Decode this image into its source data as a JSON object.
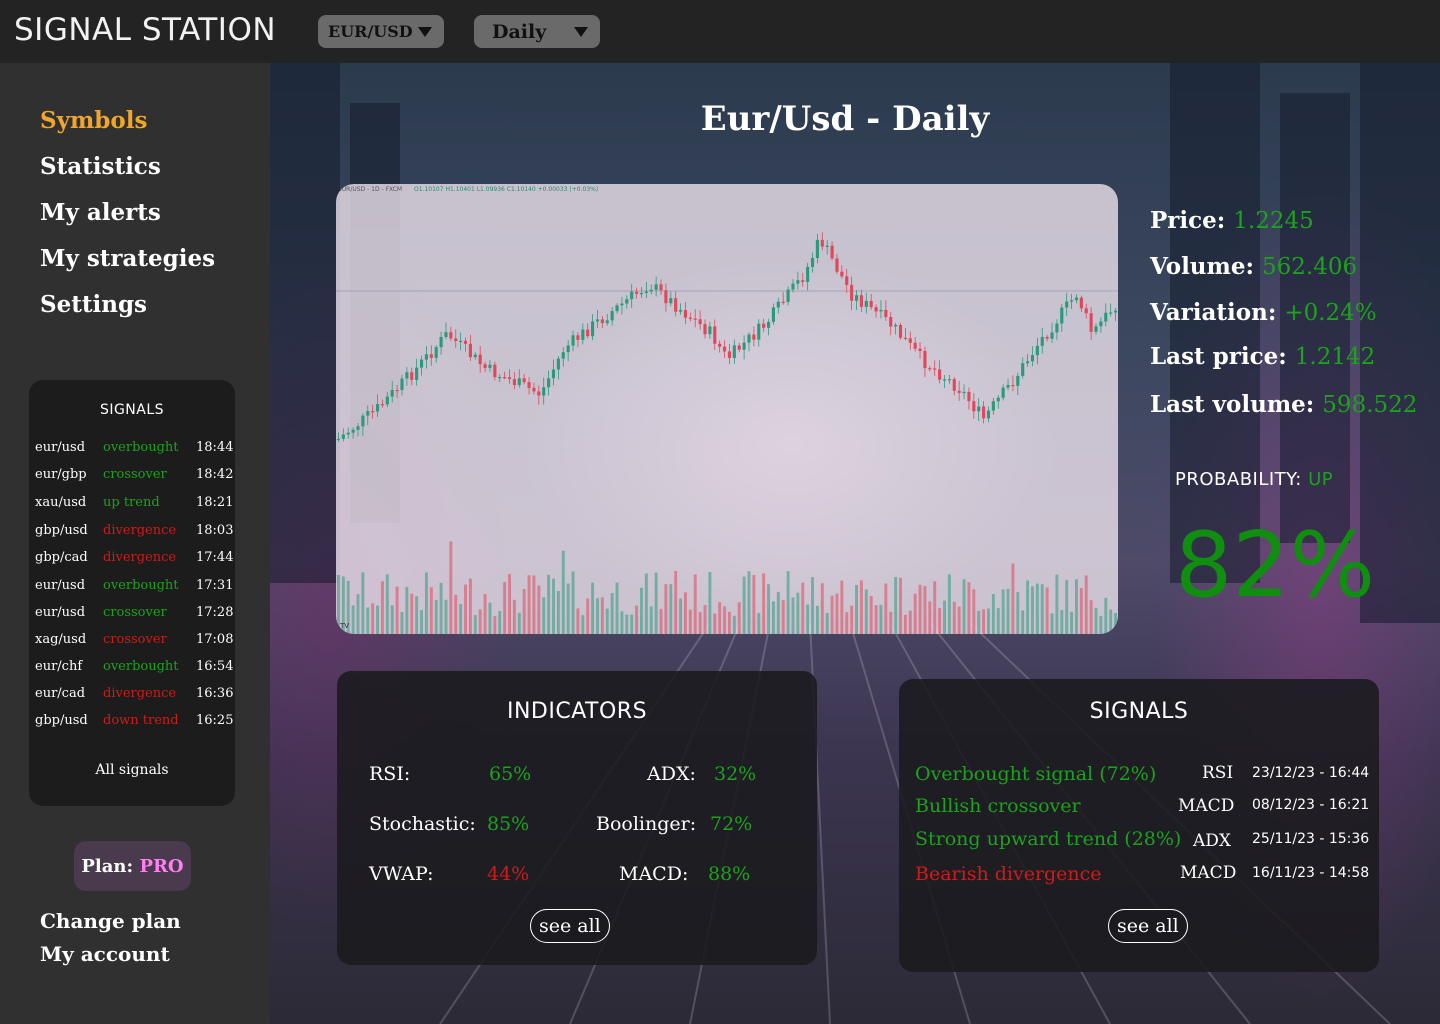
{
  "header": {
    "app_title": "SIGNAL STATION",
    "symbol_select": "EUR/USD",
    "timeframe_select": "Daily"
  },
  "sidebar": {
    "nav": [
      {
        "label": "Symbols",
        "active": true
      },
      {
        "label": "Statistics",
        "active": false
      },
      {
        "label": "My alerts",
        "active": false
      },
      {
        "label": "My strategies",
        "active": false
      },
      {
        "label": "Settings",
        "active": false
      }
    ],
    "signals_title": "SIGNALS",
    "signals": [
      {
        "pair": "eur/usd",
        "type": "overbought",
        "time": "18:44",
        "status": "green"
      },
      {
        "pair": "eur/gbp",
        "type": "crossover",
        "time": "18:42",
        "status": "green"
      },
      {
        "pair": "xau/usd",
        "type": "up trend",
        "time": "18:21",
        "status": "green"
      },
      {
        "pair": "gbp/usd",
        "type": "divergence",
        "time": "18:03",
        "status": "red"
      },
      {
        "pair": "gbp/cad",
        "type": "divergence",
        "time": "17:44",
        "status": "red"
      },
      {
        "pair": "eur/usd",
        "type": "overbought",
        "time": "17:31",
        "status": "green"
      },
      {
        "pair": "eur/usd",
        "type": "crossover",
        "time": "17:28",
        "status": "green"
      },
      {
        "pair": "xag/usd",
        "type": "crossover",
        "time": "17:08",
        "status": "red"
      },
      {
        "pair": "eur/chf",
        "type": "overbought",
        "time": "16:54",
        "status": "green"
      },
      {
        "pair": "eur/cad",
        "type": "divergence",
        "time": "16:36",
        "status": "red"
      },
      {
        "pair": "gbp/usd",
        "type": "down trend",
        "time": "16:25",
        "status": "red"
      }
    ],
    "all_signals_label": "All signals",
    "plan_label": "Plan:",
    "plan_value": "PRO",
    "change_plan": "Change plan",
    "my_account": "My account"
  },
  "main": {
    "title": "Eur/Usd  -  Daily",
    "chart_header": "EUR/USD - 1D - FXCM",
    "chart_ohlc": "O1.10107 H1.10401 L1.09936 C1.10140 +0.00033 (+0.03%)",
    "chart_footer": "TV",
    "stats": [
      {
        "label": "Price:",
        "value": "1.2245"
      },
      {
        "label": "Volume:",
        "value": "562.406"
      },
      {
        "label": "Variation:",
        "value": "+0.24%"
      },
      {
        "label": "Last price:",
        "value": "1.2142"
      },
      {
        "label": "Last volume:",
        "value": "598.522"
      }
    ],
    "probability_label": "PROBABILITY:",
    "probability_direction": "UP",
    "probability_value": "82%"
  },
  "indicators": {
    "title": "INDICATORS",
    "items": [
      {
        "label": "RSI:",
        "value": "65%",
        "status": "green"
      },
      {
        "label": "ADX:",
        "value": "32%",
        "status": "green"
      },
      {
        "label": "Stochastic:",
        "value": "85%",
        "status": "green"
      },
      {
        "label": "Boolinger:",
        "value": "72%",
        "status": "green"
      },
      {
        "label": "VWAP:",
        "value": "44%",
        "status": "red"
      },
      {
        "label": "MACD:",
        "value": "88%",
        "status": "green"
      }
    ],
    "see_all": "see all"
  },
  "signals_panel": {
    "title": "SIGNALS",
    "items": [
      {
        "text": "Overbought signal (72%)",
        "indicator": "RSI",
        "datetime": "23/12/23 - 16:44",
        "status": "green"
      },
      {
        "text": "Bullish crossover",
        "indicator": "MACD",
        "datetime": "08/12/23 - 16:21",
        "status": "green"
      },
      {
        "text": "Strong upward trend (28%)",
        "indicator": "ADX",
        "datetime": "25/11/23 - 15:36",
        "status": "green"
      },
      {
        "text": "Bearish divergence",
        "indicator": "MACD",
        "datetime": "16/11/23 - 14:58",
        "status": "red"
      }
    ],
    "see_all": "see all"
  }
}
